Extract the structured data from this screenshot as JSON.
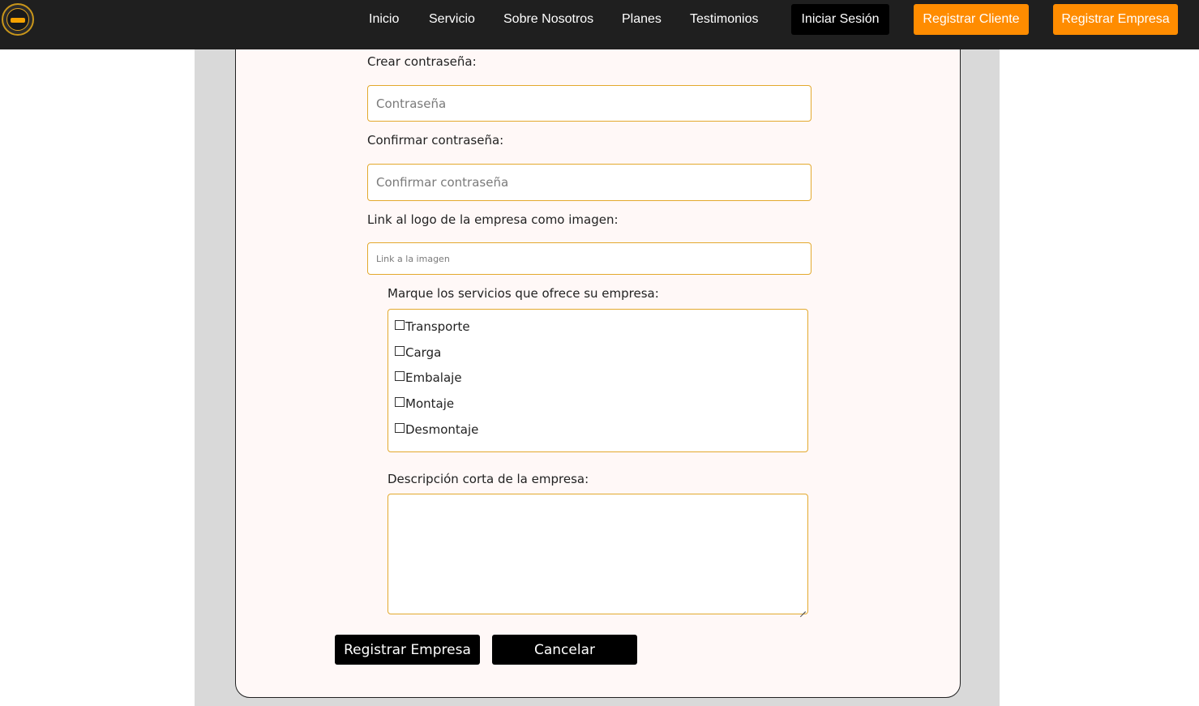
{
  "nav": {
    "logo_icon": "company-logo",
    "links": [
      "Inicio",
      "Servicio",
      "Sobre Nosotros",
      "Planes",
      "Testimonios"
    ],
    "login_label": "Iniciar Sesión",
    "register_client_label": "Registrar Cliente",
    "register_company_label": "Registrar Empresa",
    "accent_color": "#ff8c00"
  },
  "form": {
    "password_label": "Crear contraseña:",
    "password_placeholder": "Contraseña",
    "confirm_label": "Confirmar contraseña:",
    "confirm_placeholder": "Confirmar contraseña",
    "logo_link_label": "Link al logo de la empresa como imagen:",
    "logo_link_placeholder": "Link a la imagen",
    "services_label": "Marque los servicios que ofrece su empresa:",
    "services": [
      "Transporte",
      "Carga",
      "Embalaje",
      "Montaje",
      "Desmontaje"
    ],
    "description_label": "Descripción corta de la empresa:",
    "submit_label": "Registrar Empresa",
    "cancel_label": "Cancelar",
    "input_border_color": "#e3a92e"
  }
}
